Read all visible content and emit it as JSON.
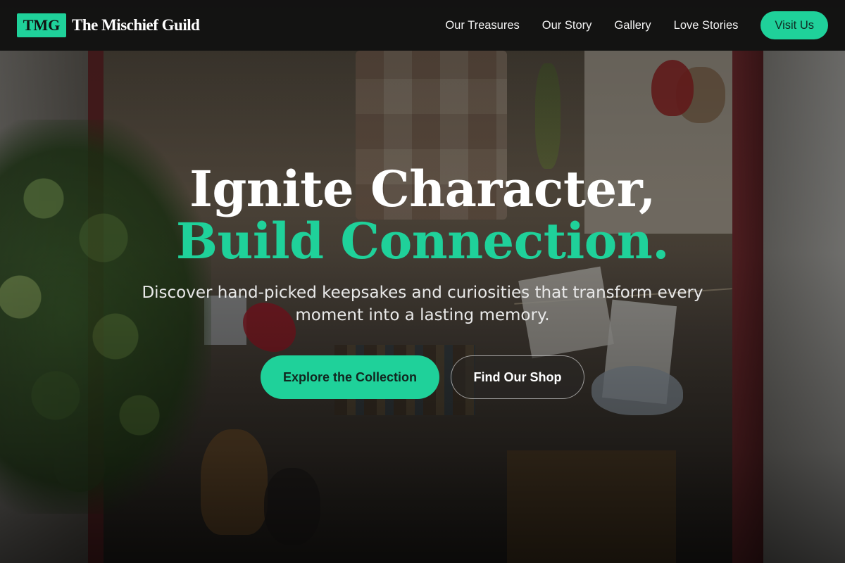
{
  "theme": {
    "accent": "#1fd19a",
    "nav_bg": "#121212"
  },
  "brand": {
    "badge": "TMG",
    "name": "The Mischief Guild"
  },
  "nav": {
    "links": [
      "Our Treasures",
      "Our Story",
      "Gallery",
      "Love Stories"
    ],
    "cta_label": "Visit Us"
  },
  "hero": {
    "headline_line1": "Ignite Character,",
    "headline_line2": "Build Connection.",
    "subtitle": "Discover hand-picked keepsakes and curiosities that transform every moment into a lasting memory.",
    "primary_button": "Explore the Collection",
    "secondary_button": "Find Our Shop",
    "background_image": "shop-window-photo"
  }
}
